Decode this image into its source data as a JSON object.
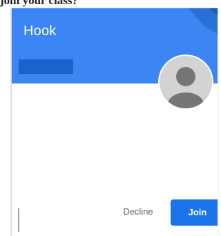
{
  "caption": {
    "text": "join your class?"
  },
  "card": {
    "class_name": "Hook",
    "banner_color": "#3b86f2",
    "redacted_subtitle": "",
    "avatar_icon": "person-avatar-icon"
  },
  "actions": {
    "decline_label": "Decline",
    "join_label": "Join",
    "join_color": "#1a73e8"
  }
}
